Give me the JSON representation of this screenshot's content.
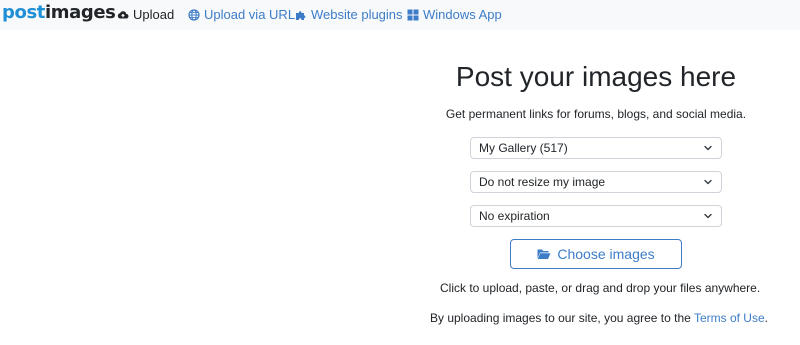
{
  "navbar": {
    "logo": {
      "part1": "post",
      "part2": "images"
    },
    "items": [
      {
        "label": "Upload",
        "icon": "cloud-upload-icon"
      },
      {
        "label": "Upload via URL",
        "icon": "globe-icon"
      },
      {
        "label": "Website plugins",
        "icon": "puzzle-icon"
      },
      {
        "label": "Windows App",
        "icon": "windows-icon"
      }
    ]
  },
  "main": {
    "title": "Post your images here",
    "subtitle": "Get permanent links for forums, blogs, and social media.",
    "gallery_select": {
      "value": "My Gallery (517)"
    },
    "resize_select": {
      "value": "Do not resize my image"
    },
    "expiration_select": {
      "value": "No expiration"
    },
    "choose_button": {
      "label": "Choose images",
      "icon": "folder-open-icon"
    },
    "hint": "Click to upload, paste, or drag and drop your files anywhere.",
    "terms": {
      "prefix": "By uploading images to our site, you agree to the ",
      "link": "Terms of Use",
      "suffix": "."
    }
  },
  "colors": {
    "accent": "#3d7cc9",
    "logo_blue": "#1f8fd6",
    "navbar_bg": "#f8f9fa",
    "text": "#212529"
  }
}
